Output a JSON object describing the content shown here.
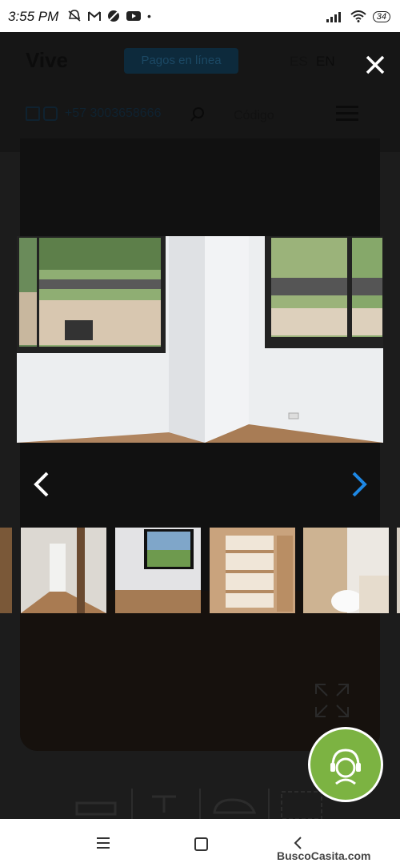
{
  "status_bar": {
    "time": "3:55 PM",
    "battery": "34"
  },
  "site": {
    "logo": "Vive",
    "pay_button": "Pagos en línea",
    "lang_es": "ES",
    "lang_en": "EN",
    "phone": "+57 3003658666",
    "code_placeholder": "Código"
  },
  "lightbox": {
    "close_icon": "close-icon",
    "prev_icon": "chevron-left-icon",
    "next_icon": "chevron-right-icon",
    "accent": "#1e88e5"
  },
  "chat": {
    "icon": "support-agent-icon",
    "color": "#7cb342"
  },
  "watermark": "BuscoCasita.com"
}
